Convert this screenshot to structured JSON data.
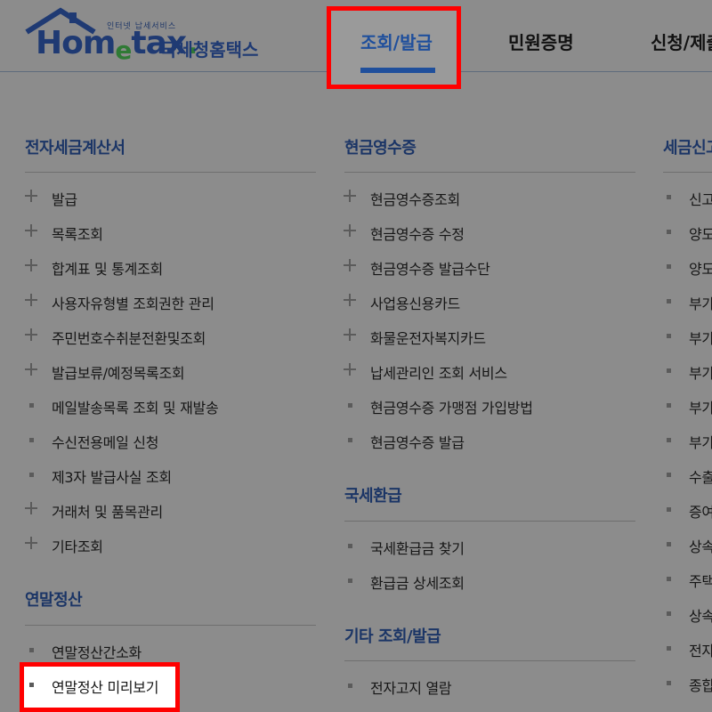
{
  "brand": {
    "tagline": "인터넷 납세서비스",
    "name_main": "Hom",
    "name_e": "e",
    "name_rest": "tax",
    "name_dot": ".",
    "name_ko": "국세청홈택스"
  },
  "nav": {
    "tabs": [
      {
        "label": "조회/발급",
        "active": true
      },
      {
        "label": "민원증명",
        "active": false
      },
      {
        "label": "신청/제출",
        "active": false
      }
    ]
  },
  "columns": [
    {
      "sections": [
        {
          "title": "전자세금계산서",
          "items": [
            {
              "label": "발급",
              "icon": "plus"
            },
            {
              "label": "목록조회",
              "icon": "plus"
            },
            {
              "label": "합계표 및 통계조회",
              "icon": "plus"
            },
            {
              "label": "사용자유형별 조회권한 관리",
              "icon": "plus"
            },
            {
              "label": "주민번호수취분전환및조회",
              "icon": "plus"
            },
            {
              "label": "발급보류/예정목록조회",
              "icon": "plus"
            },
            {
              "label": "메일발송목록 조회 및 재발송",
              "icon": "square"
            },
            {
              "label": "수신전용메일 신청",
              "icon": "square"
            },
            {
              "label": "제3자 발급사실 조회",
              "icon": "square"
            },
            {
              "label": "거래처 및 품목관리",
              "icon": "plus"
            },
            {
              "label": "기타조회",
              "icon": "plus"
            }
          ]
        },
        {
          "title": "연말정산",
          "items": [
            {
              "label": "연말정산간소화",
              "icon": "square"
            },
            {
              "label": "연말정산 미리보기",
              "icon": "square"
            }
          ]
        }
      ]
    },
    {
      "sections": [
        {
          "title": "현금영수증",
          "items": [
            {
              "label": "현금영수증조회",
              "icon": "plus"
            },
            {
              "label": "현금영수증 수정",
              "icon": "plus"
            },
            {
              "label": "현금영수증 발급수단",
              "icon": "plus"
            },
            {
              "label": "사업용신용카드",
              "icon": "plus"
            },
            {
              "label": "화물운전자복지카드",
              "icon": "plus"
            },
            {
              "label": "납세관리인 조회 서비스",
              "icon": "plus"
            },
            {
              "label": "현금영수증 가맹점 가입방법",
              "icon": "square"
            },
            {
              "label": "현금영수증 발급",
              "icon": "square"
            }
          ]
        },
        {
          "title": "국세환급",
          "items": [
            {
              "label": "국세환급금 찾기",
              "icon": "square"
            },
            {
              "label": "환급금 상세조회",
              "icon": "square"
            }
          ]
        },
        {
          "title": "기타 조회/발급",
          "items": [
            {
              "label": "전자고지 열람",
              "icon": "square"
            }
          ]
        }
      ]
    },
    {
      "sections": [
        {
          "title": "세금신고",
          "items": [
            {
              "label": "신고",
              "icon": "square"
            },
            {
              "label": "양도",
              "icon": "square"
            },
            {
              "label": "양도",
              "icon": "square"
            },
            {
              "label": "부가",
              "icon": "square"
            },
            {
              "label": "부가",
              "icon": "square"
            },
            {
              "label": "부가",
              "icon": "square"
            },
            {
              "label": "부가",
              "icon": "square"
            },
            {
              "label": "부가",
              "icon": "square"
            },
            {
              "label": "수출",
              "icon": "square"
            },
            {
              "label": "증여",
              "icon": "square"
            },
            {
              "label": "상속",
              "icon": "square"
            },
            {
              "label": "주택",
              "icon": "square"
            },
            {
              "label": "상속",
              "icon": "square"
            },
            {
              "label": "전자",
              "icon": "square"
            },
            {
              "label": "종합",
              "icon": "square"
            }
          ]
        }
      ]
    }
  ],
  "colors": {
    "accent": "#1f4f9c",
    "section_title": "#1b3566",
    "highlight": "#ff0000",
    "overlay": "#8c8c8c"
  }
}
